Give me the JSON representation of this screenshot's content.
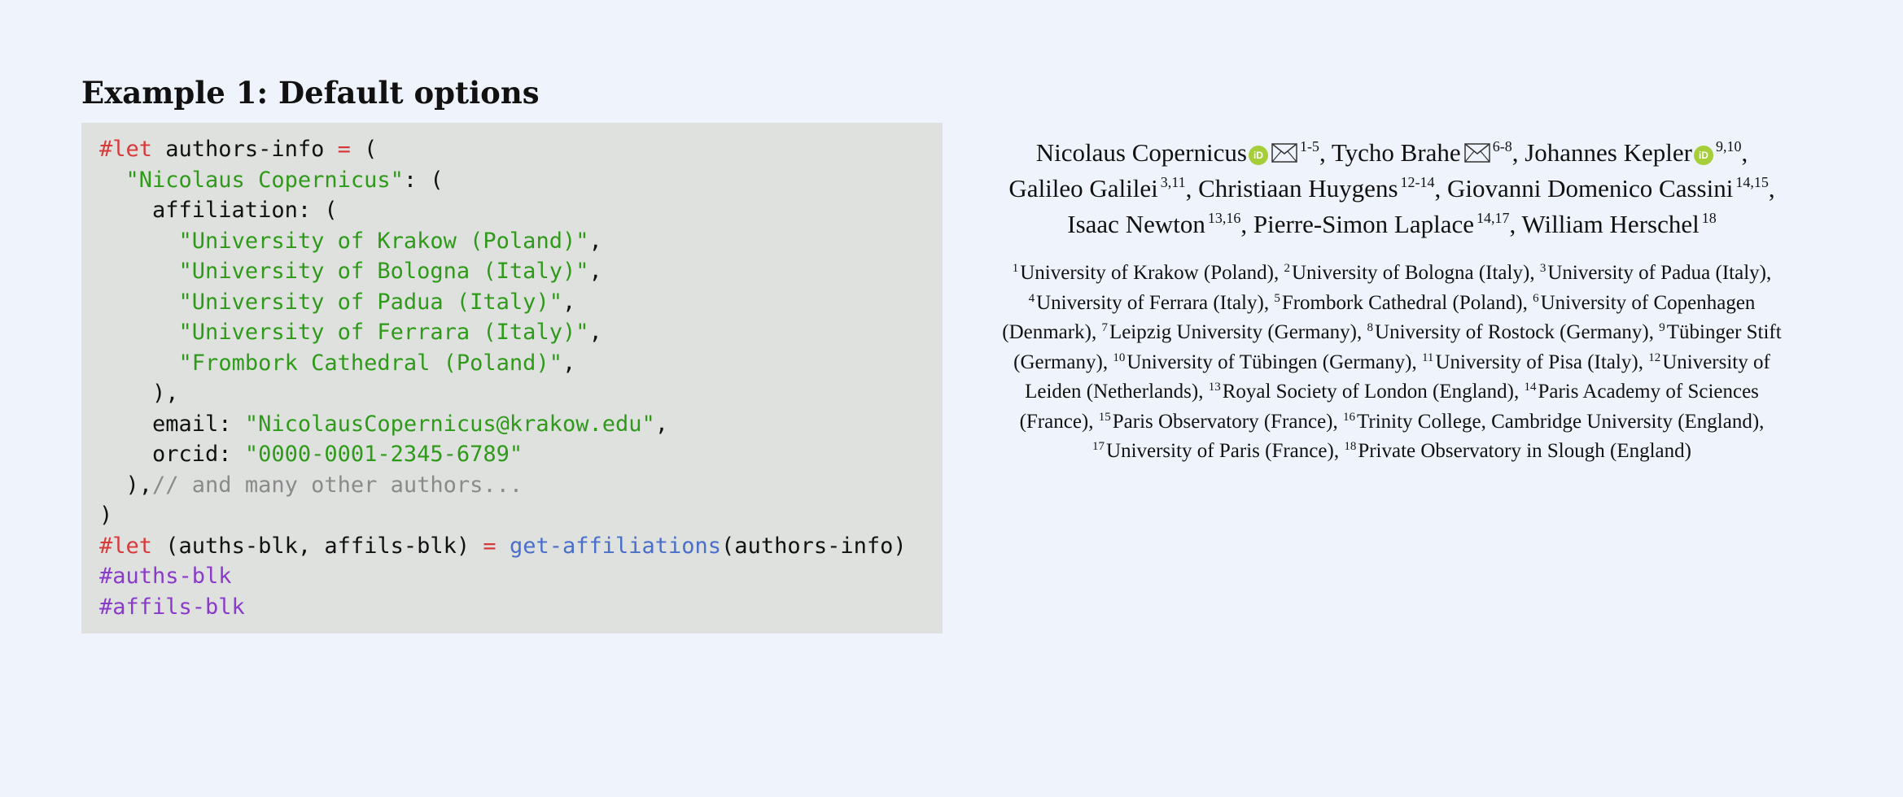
{
  "heading": "Example 1: Default options",
  "code": {
    "lines": [
      [
        {
          "c": "kw",
          "t": "#let"
        },
        {
          "c": "",
          "t": " authors-info "
        },
        {
          "c": "op",
          "t": "="
        },
        {
          "c": "",
          "t": " ("
        }
      ],
      [
        {
          "c": "",
          "t": "  "
        },
        {
          "c": "str",
          "t": "\"Nicolaus Copernicus\""
        },
        {
          "c": "",
          "t": ": ("
        }
      ],
      [
        {
          "c": "",
          "t": "    affiliation: ("
        }
      ],
      [
        {
          "c": "",
          "t": "      "
        },
        {
          "c": "str",
          "t": "\"University of Krakow (Poland)\""
        },
        {
          "c": "",
          "t": ","
        }
      ],
      [
        {
          "c": "",
          "t": "      "
        },
        {
          "c": "str",
          "t": "\"University of Bologna (Italy)\""
        },
        {
          "c": "",
          "t": ","
        }
      ],
      [
        {
          "c": "",
          "t": "      "
        },
        {
          "c": "str",
          "t": "\"University of Padua (Italy)\""
        },
        {
          "c": "",
          "t": ","
        }
      ],
      [
        {
          "c": "",
          "t": "      "
        },
        {
          "c": "str",
          "t": "\"University of Ferrara (Italy)\""
        },
        {
          "c": "",
          "t": ","
        }
      ],
      [
        {
          "c": "",
          "t": "      "
        },
        {
          "c": "str",
          "t": "\"Frombork Cathedral (Poland)\""
        },
        {
          "c": "",
          "t": ","
        }
      ],
      [
        {
          "c": "",
          "t": "    ),"
        }
      ],
      [
        {
          "c": "",
          "t": "    email: "
        },
        {
          "c": "str",
          "t": "\"NicolausCopernicus@krakow.edu\""
        },
        {
          "c": "",
          "t": ","
        }
      ],
      [
        {
          "c": "",
          "t": "    orcid: "
        },
        {
          "c": "str",
          "t": "\"0000-0001-2345-6789\""
        }
      ],
      [
        {
          "c": "",
          "t": "  ),"
        },
        {
          "c": "cm",
          "t": "// and many other authors..."
        }
      ],
      [
        {
          "c": "",
          "t": ")"
        }
      ],
      [
        {
          "c": "kw",
          "t": "#let"
        },
        {
          "c": "",
          "t": " (auths-blk, affils-blk) "
        },
        {
          "c": "op",
          "t": "="
        },
        {
          "c": "",
          "t": " "
        },
        {
          "c": "fn",
          "t": "get-affiliations"
        },
        {
          "c": "",
          "t": "(authors-info)"
        }
      ],
      [
        {
          "c": "var",
          "t": "#auths-blk"
        }
      ],
      [
        {
          "c": "var",
          "t": "#affils-blk"
        }
      ]
    ]
  },
  "authors": [
    {
      "name": "Nicolaus Copernicus",
      "orcid": true,
      "email": true,
      "sup": "1-5",
      "sep": ","
    },
    {
      "name": "Tycho Brahe",
      "orcid": false,
      "email": true,
      "sup": "6-8",
      "sep": ","
    },
    {
      "name": "Johannes Kepler",
      "orcid": true,
      "email": false,
      "sup": "9,10",
      "sep": ","
    },
    {
      "name": "Galileo Galilei",
      "orcid": false,
      "email": false,
      "sup": "3,11",
      "sep": ","
    },
    {
      "name": "Christiaan Huygens",
      "orcid": false,
      "email": false,
      "sup": "12-14",
      "sep": ","
    },
    {
      "name": "Giovanni Domenico Cassini",
      "orcid": false,
      "email": false,
      "sup": "14,15",
      "sep": ","
    },
    {
      "name": "Isaac Newton",
      "orcid": false,
      "email": false,
      "sup": "13,16",
      "sep": ","
    },
    {
      "name": "Pierre-Simon Laplace",
      "orcid": false,
      "email": false,
      "sup": "14,17",
      "sep": ","
    },
    {
      "name": "William Herschel",
      "orcid": false,
      "email": false,
      "sup": "18",
      "sep": ""
    }
  ],
  "orcid_icon_text": "iD",
  "affiliations": [
    {
      "num": "1",
      "name": "University of Krakow (Poland)"
    },
    {
      "num": "2",
      "name": "University of Bologna (Italy)"
    },
    {
      "num": "3",
      "name": "University of Padua (Italy)"
    },
    {
      "num": "4",
      "name": "University of Ferrara (Italy)"
    },
    {
      "num": "5",
      "name": "Frombork Cathedral (Poland)"
    },
    {
      "num": "6",
      "name": "University of Copenhagen (Denmark)"
    },
    {
      "num": "7",
      "name": "Leipzig University (Germany)"
    },
    {
      "num": "8",
      "name": "University of Rostock (Germany)"
    },
    {
      "num": "9",
      "name": "Tübinger Stift (Germany)"
    },
    {
      "num": "10",
      "name": "University of Tübingen (Germany)"
    },
    {
      "num": "11",
      "name": "University of Pisa (Italy)"
    },
    {
      "num": "12",
      "name": "University of Leiden (Netherlands)"
    },
    {
      "num": "13",
      "name": "Royal Society of London (England)"
    },
    {
      "num": "14",
      "name": "Paris Academy of Sciences (France)"
    },
    {
      "num": "15",
      "name": "Paris Observatory (France)"
    },
    {
      "num": "16",
      "name": "Trinity College, Cambridge University (England)"
    },
    {
      "num": "17",
      "name": "University of Paris (France)"
    },
    {
      "num": "18",
      "name": "Private Observatory in Slough (England)"
    }
  ],
  "colors": {
    "background": "#eff4fc",
    "code_background": "#dfe1df",
    "keyword": "#d73a3a",
    "string": "#2f9a1a",
    "function": "#4a6fc9",
    "comment": "#8a8a8a",
    "variable": "#8a3ac9",
    "orcid": "#a6ce39"
  }
}
